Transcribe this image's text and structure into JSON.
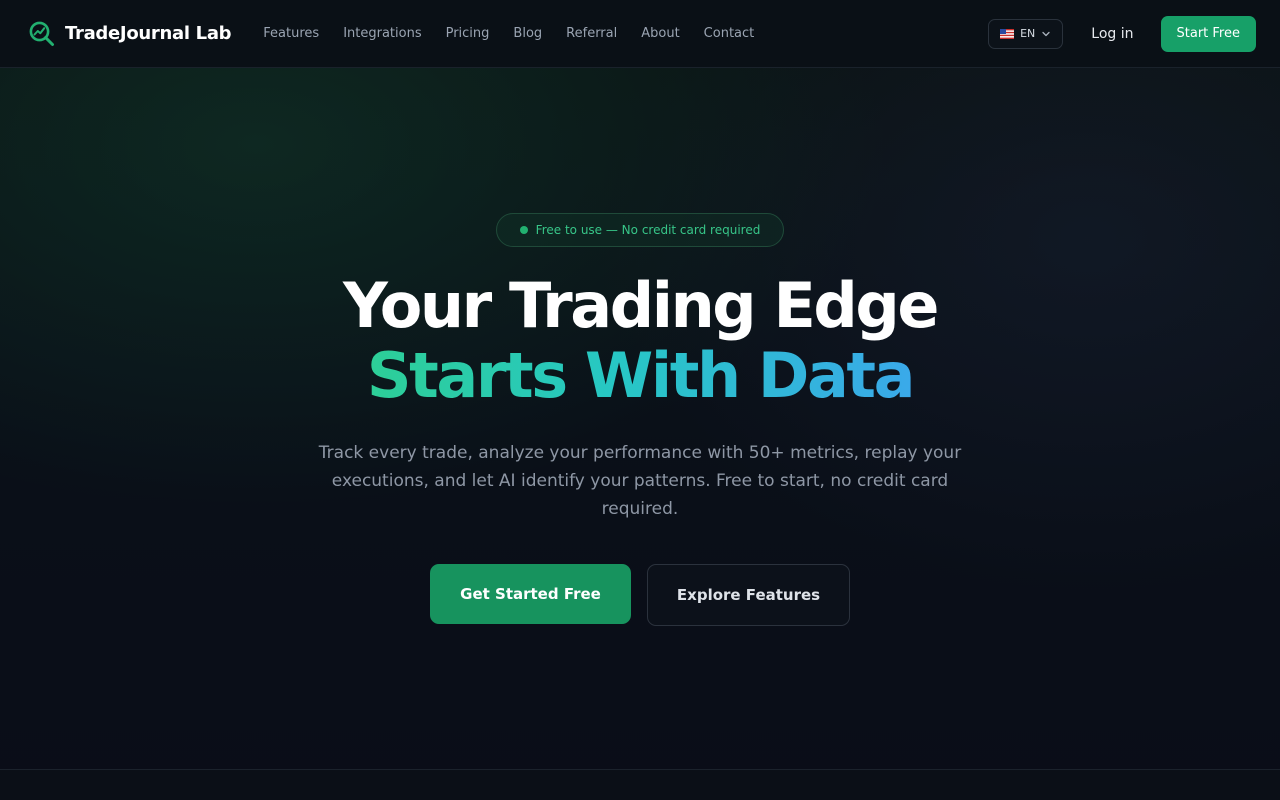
{
  "brand": {
    "name": "TradeJournal Lab",
    "icon": "magnifier-chart-icon",
    "accent": "#22b070"
  },
  "nav": {
    "links": [
      "Features",
      "Integrations",
      "Pricing",
      "Blog",
      "Referral",
      "About",
      "Contact"
    ],
    "language": {
      "flag": "us-flag-icon",
      "code": "EN"
    },
    "login_label": "Log in",
    "start_label": "Start Free"
  },
  "hero": {
    "badge": "Free to use — No credit card required",
    "headline_line1": "Your Trading Edge",
    "headline_line2": "Starts With Data",
    "subtext": "Track every trade, analyze your performance with 50+ metrics, replay your executions, and let AI identify your patterns. Free to start, no credit card required.",
    "primary_cta": "Get Started Free",
    "secondary_cta": "Explore Features"
  },
  "colors": {
    "primary_button": "#17935e",
    "gradient_start": "#2dcf97",
    "gradient_end": "#3aa9ea",
    "background": "#0a0e16"
  }
}
